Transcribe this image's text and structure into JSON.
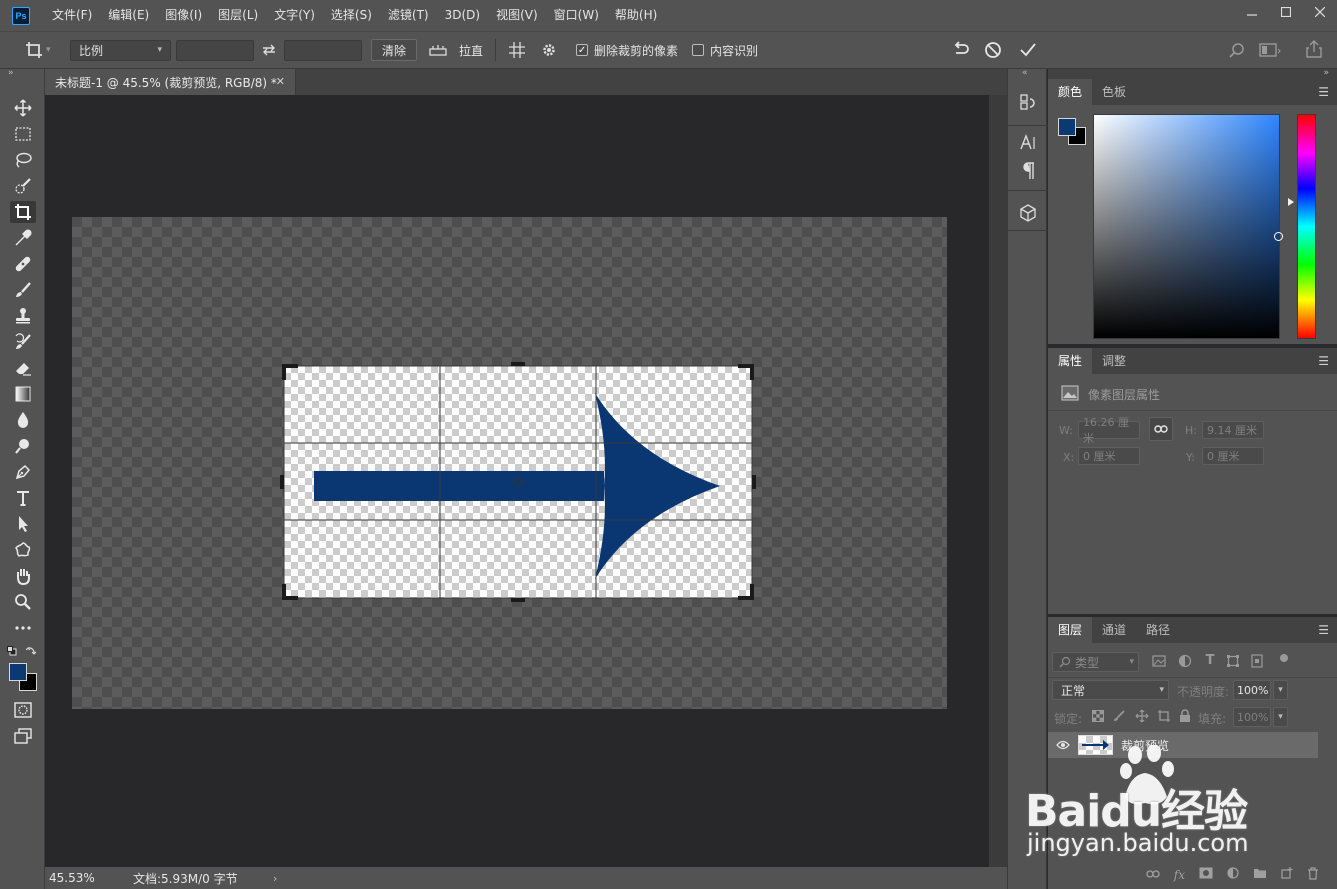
{
  "app": {
    "logo_text": "Ps",
    "menu": [
      "文件(F)",
      "编辑(E)",
      "图像(I)",
      "图层(L)",
      "文字(Y)",
      "选择(S)",
      "滤镜(T)",
      "3D(D)",
      "视图(V)",
      "窗口(W)",
      "帮助(H)"
    ]
  },
  "options_bar": {
    "ratio_select": "比例",
    "width_value": "",
    "height_value": "",
    "clear_label": "清除",
    "straighten_label": "拉直",
    "delete_cropped_label": "删除裁剪的像素",
    "delete_cropped_checked": true,
    "content_aware_label": "内容识别",
    "content_aware_checked": false
  },
  "document": {
    "tab_title": "未标题-1 @ 45.5% (裁剪预览, RGB/8) *",
    "zoom": "45.53%",
    "doc_info": "文档:5.93M/0 字节"
  },
  "colors": {
    "foreground": "#0a3a72",
    "background": "#000000",
    "arrow": "#0a3772",
    "accent": "#31a8ff"
  },
  "panels": {
    "color": {
      "tabs": [
        "颜色",
        "色板"
      ]
    },
    "properties": {
      "tabs": [
        "属性",
        "调整"
      ],
      "header": "像素图层属性",
      "w_label": "W:",
      "w_value": "16.26 厘米",
      "h_label": "H:",
      "h_value": "9.14 厘米",
      "x_label": "X:",
      "x_value": "0 厘米",
      "y_label": "Y:",
      "y_value": "0 厘米"
    },
    "layers": {
      "tabs": [
        "图层",
        "通道",
        "路径"
      ],
      "filter_placeholder": "类型",
      "blend_mode": "正常",
      "opacity_label": "不透明度:",
      "opacity_value": "100%",
      "lock_label": "锁定:",
      "fill_label": "填充:",
      "fill_value": "100%",
      "layer_name": "裁剪预览"
    }
  },
  "watermark": {
    "brand": "Baidu经验",
    "url": "jingyan.baidu.com"
  }
}
